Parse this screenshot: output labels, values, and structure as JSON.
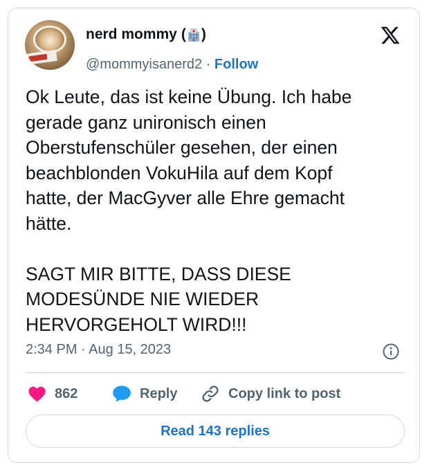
{
  "author": {
    "name": "nerd mommy",
    "name_paren_open": "(",
    "name_paren_close": ")",
    "name_emoji": "hospital-icon",
    "handle": "@mommyisanerd2",
    "separator": "·",
    "follow_label": "Follow"
  },
  "brand": {
    "logo": "x-logo-icon"
  },
  "tweet": {
    "text": "Ok Leute, das ist keine Übung. Ich habe\ngerade ganz unironisch einen\nOberstufenschüler gesehen, der einen\nbeachblonden VokuHila auf dem Kopf\nhatte, der MacGyver alle Ehre gemacht\nhätte.\n\nSAGT MIR BITTE, DASS DIESE\nMODESÜNDE NIE WIEDER\nHERVORGEHOLT WIRD!!!",
    "time": "2:34 PM",
    "date": "Aug 15, 2023",
    "time_date_separator": "·"
  },
  "actions": {
    "like_count": "862",
    "reply_label": "Reply",
    "copy_label": "Copy link to post"
  },
  "replies_button": {
    "label": "Read 143 replies"
  },
  "colors": {
    "like": "#f91880",
    "reply": "#1d9bf0",
    "link": "#1d74c4",
    "muted": "#536471",
    "border": "#cfd9de"
  }
}
